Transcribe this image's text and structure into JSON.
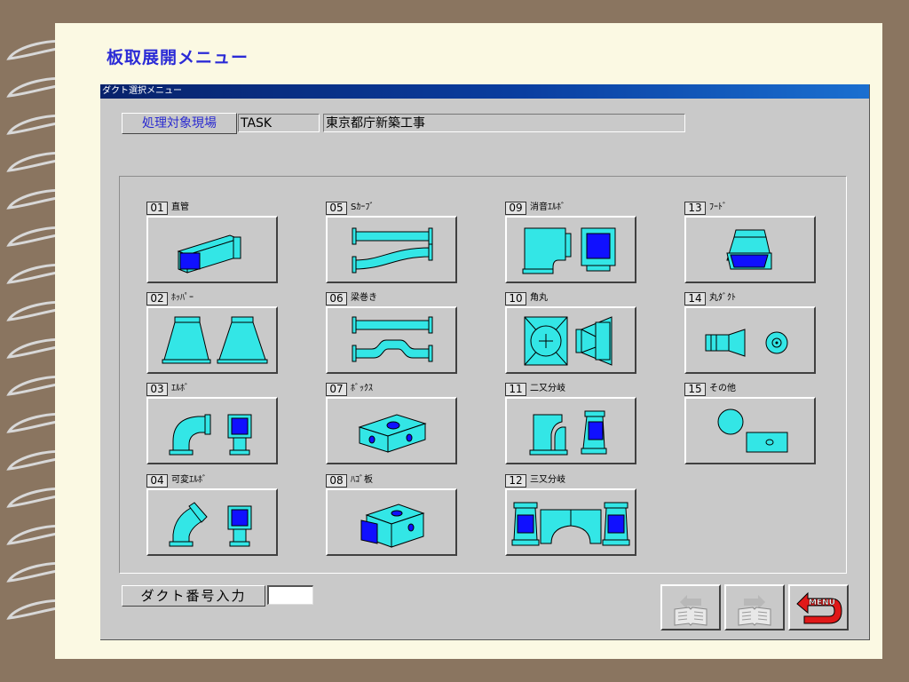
{
  "page_title": "板取展開メニュー",
  "window": {
    "title": "ダクト選択メニュー"
  },
  "site": {
    "label": "処理対象現場",
    "code": "TASK",
    "name": "東京都庁新築工事"
  },
  "items": [
    {
      "num": "01",
      "name": "直管"
    },
    {
      "num": "02",
      "name": "ﾎｯﾊﾟｰ"
    },
    {
      "num": "03",
      "name": "ｴﾙﾎﾞ"
    },
    {
      "num": "04",
      "name": "可変ｴﾙﾎﾞ"
    },
    {
      "num": "05",
      "name": "Sｶｰﾌﾞ"
    },
    {
      "num": "06",
      "name": "梁巻き"
    },
    {
      "num": "07",
      "name": "ﾎﾞｯｸｽ"
    },
    {
      "num": "08",
      "name": "ﾊｺﾞ板"
    },
    {
      "num": "09",
      "name": "消音ｴﾙﾎﾞ"
    },
    {
      "num": "10",
      "name": "角丸"
    },
    {
      "num": "11",
      "name": "二又分岐"
    },
    {
      "num": "12",
      "name": "三又分岐"
    },
    {
      "num": "13",
      "name": "ﾌｰﾄﾞ"
    },
    {
      "num": "14",
      "name": "丸ﾀﾞｸﾄ"
    },
    {
      "num": "15",
      "name": "その他"
    }
  ],
  "duct_number": {
    "label": "ダクト番号入力",
    "value": ""
  },
  "nav": {
    "menu_label": "MENU"
  },
  "colors": {
    "duct_fill": "#33e6e6",
    "duct_face": "#1010ff",
    "title_text": "#2b2bd6",
    "titlebar": "#0a3ea0",
    "menu_red": "#e01818"
  }
}
